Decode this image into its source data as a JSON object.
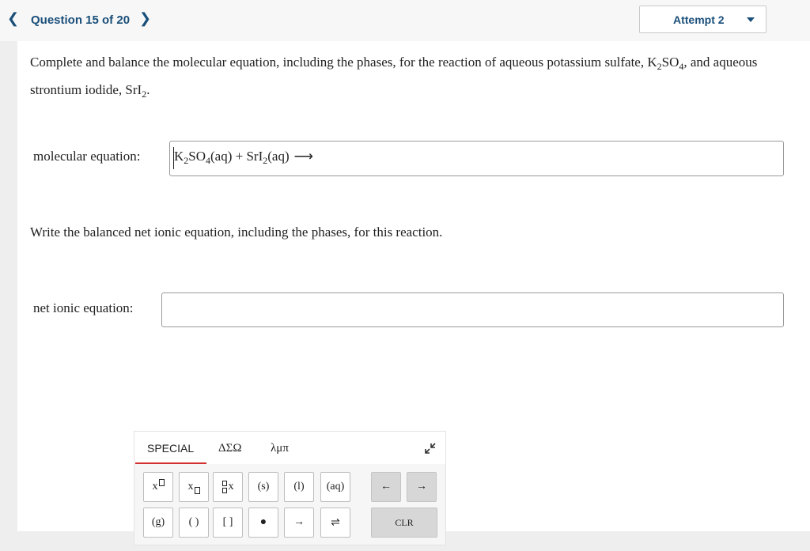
{
  "header": {
    "question_label": "Question 15 of 20",
    "attempt_label": "Attempt 2"
  },
  "question": {
    "text_part1": "Complete and balance the molecular equation, including the phases, for the reaction of aqueous potassium sulfate, K",
    "k_sub": "2",
    "so": "SO",
    "so_sub": "4",
    "text_part2": ", and aqueous strontium iodide, SrI",
    "sri_sub": "2",
    "text_part3": "."
  },
  "molecular_equation": {
    "label": "molecular equation:",
    "k": "K",
    "k_sub": "2",
    "so": "SO",
    "so_sub": "4",
    "part_a": "(aq) + SrI",
    "sri_sub": "2",
    "part_b": "(aq)",
    "arrow": "⟶"
  },
  "instruction": "Write the balanced net ionic equation, including the phases, for this reaction.",
  "net_ionic_equation": {
    "label": "net ionic equation:"
  },
  "palette": {
    "tabs": [
      "SPECIAL",
      "ΔΣΩ",
      "λμπ"
    ],
    "keys_row1": [
      "x",
      "x",
      "x",
      "(s)",
      "(l)",
      "(aq)",
      "←",
      "→"
    ],
    "keys_row2": [
      "(g)",
      "( )",
      "[ ]",
      "●",
      "→",
      "⇌",
      "CLR"
    ]
  }
}
